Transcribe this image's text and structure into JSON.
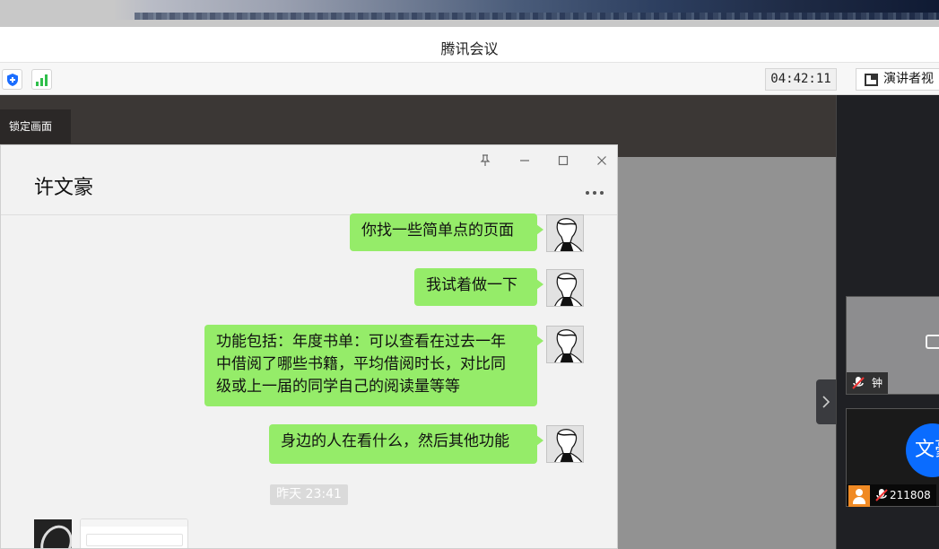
{
  "meeting": {
    "app_title": "腾讯会议",
    "timer": "04:42:11",
    "view_button_label": "演讲者视",
    "lock_screen_label": "锁定画面"
  },
  "participants": [
    {
      "name": "钟",
      "mic": "muted",
      "camera": "off"
    },
    {
      "name": "211808",
      "mic": "muted",
      "avatar_text": "文豪",
      "avatar_color": "#0a6cff"
    }
  ],
  "chat": {
    "contact_name": "许文豪",
    "messages": [
      {
        "side": "right",
        "lines": [
          "你找一些简单点的页面"
        ]
      },
      {
        "side": "right",
        "lines": [
          "我试着做一下"
        ]
      },
      {
        "side": "right",
        "lines": [
          "功能包括：年度书单：可以查看在过去一年",
          "中借阅了哪些书籍，平均借阅时长，对比同",
          "级或上一届的同学自己的阅读量等等"
        ]
      },
      {
        "side": "right",
        "lines": [
          "身边的人在看什么，然后其他功能"
        ]
      }
    ],
    "timestamp": "昨天 23:41",
    "bubble_color": "#95ec69"
  },
  "colors": {
    "toolbar_bg": "#f7f7f7",
    "share_bg": "#3a3634",
    "signal_green": "#2fbf4b",
    "shield_blue": "#1a6dff"
  }
}
